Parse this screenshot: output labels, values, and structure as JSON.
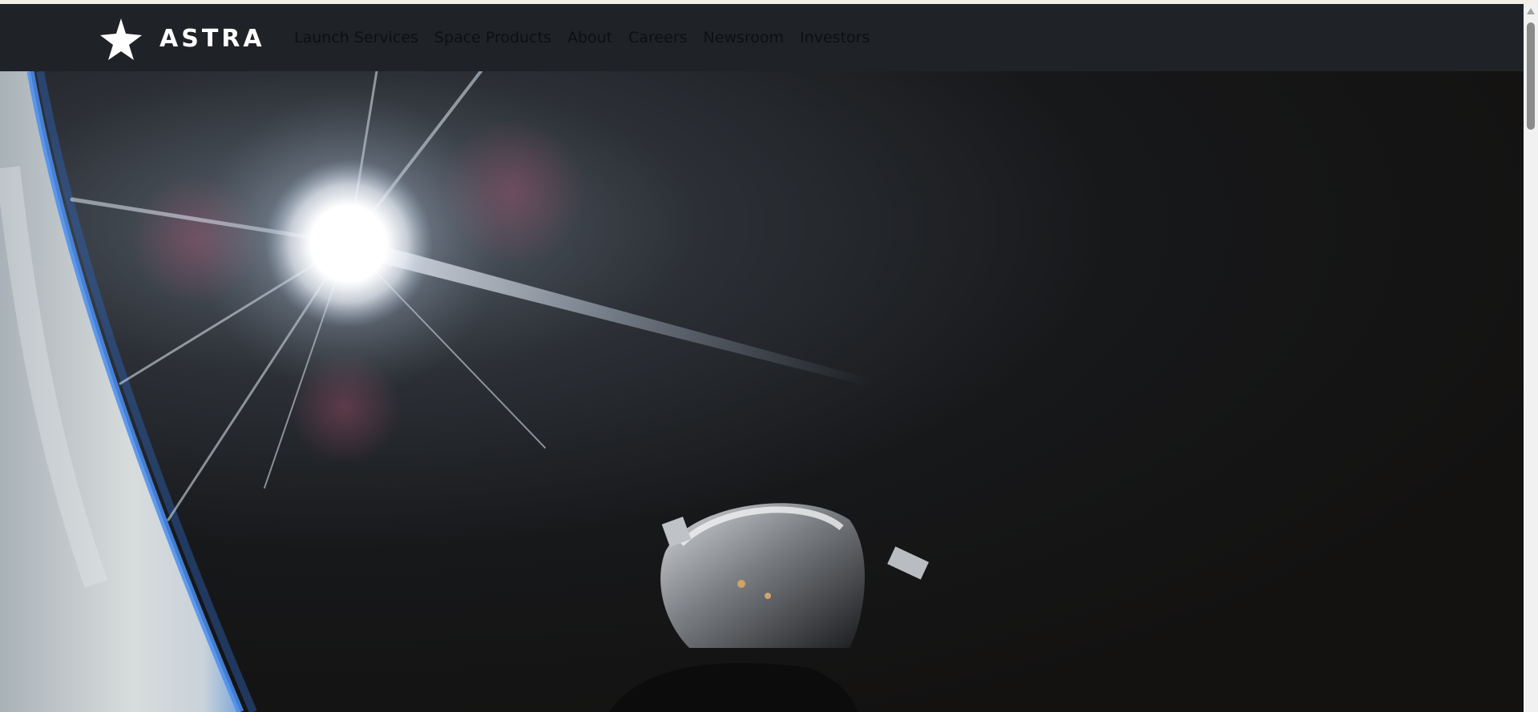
{
  "brand": {
    "name": "ASTRA",
    "logo_icon": "star-icon"
  },
  "nav": {
    "items": [
      {
        "label": "Launch Services"
      },
      {
        "label": "Space Products"
      },
      {
        "label": "About"
      },
      {
        "label": "Careers"
      },
      {
        "label": "Newsroom"
      },
      {
        "label": "Investors"
      }
    ]
  },
  "hero": {
    "image_icon": "space-hero-image"
  },
  "colors": {
    "navbar_bg": "#1f2227",
    "nav_link": "#0d0f12",
    "hero_bg": "#131211",
    "top_strip": "#f4efe6"
  }
}
